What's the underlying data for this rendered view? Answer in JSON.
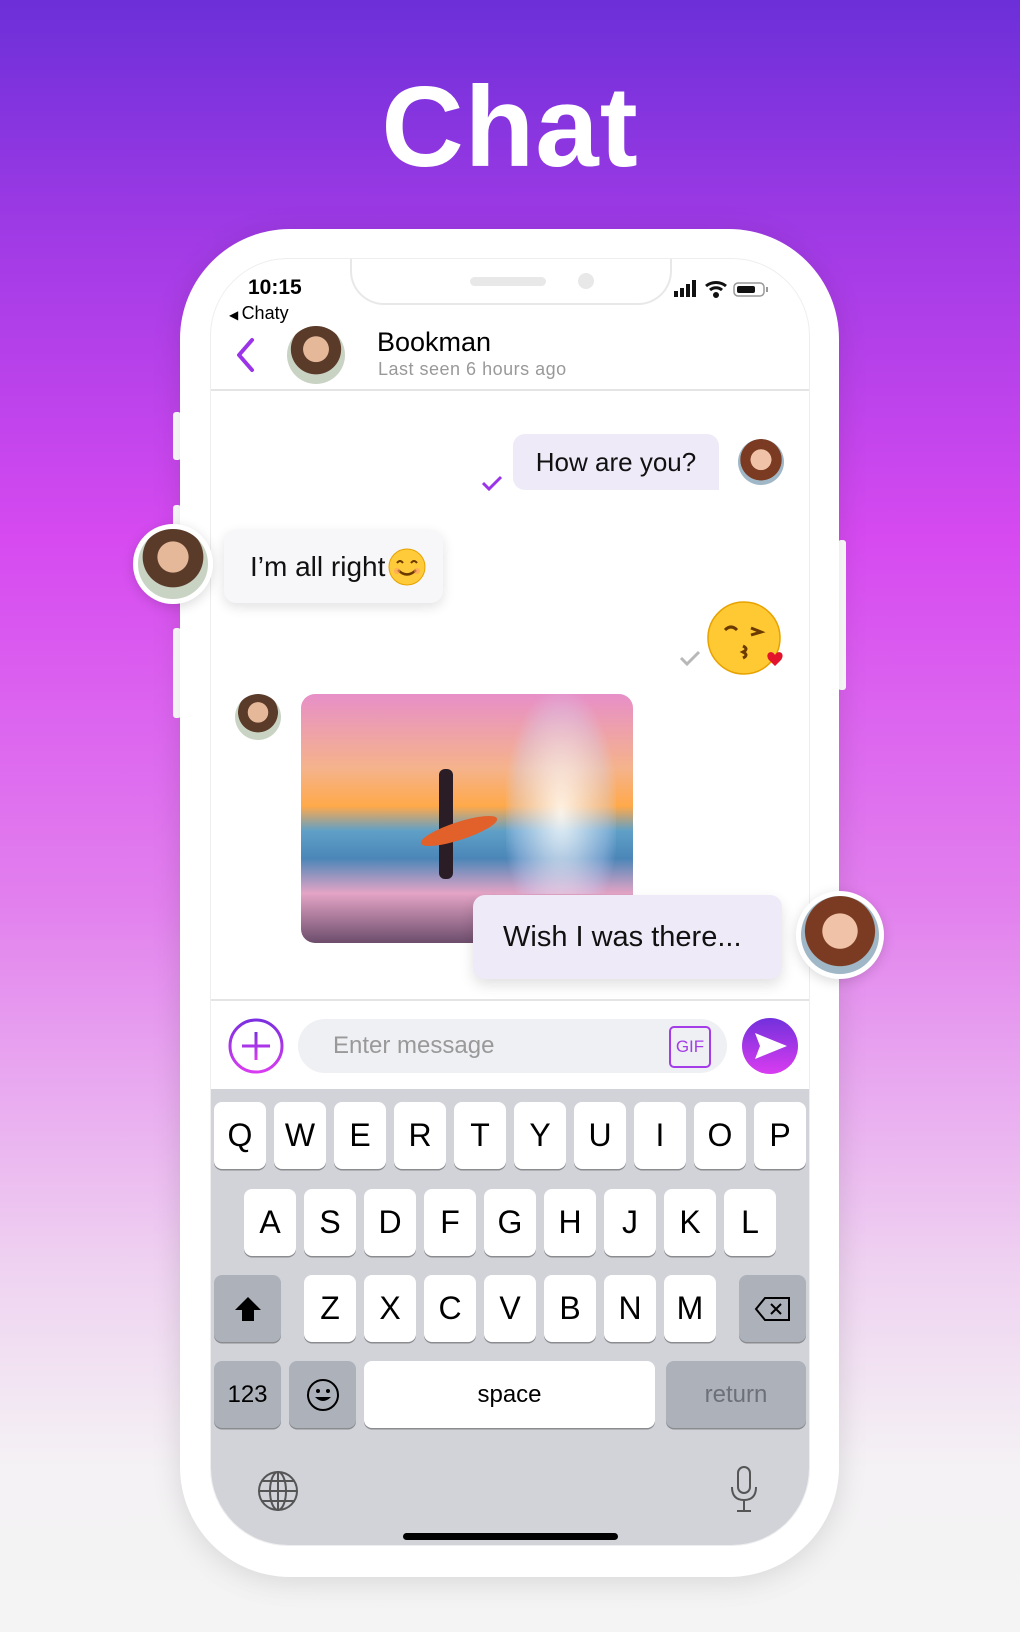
{
  "hero_title": "Chat",
  "status": {
    "time": "10:15",
    "back_app": "Chaty"
  },
  "header": {
    "name": "Bookman",
    "last_seen": "Last seen 6 hours ago"
  },
  "messages": [
    {
      "from": "me",
      "text": "How are you?",
      "status": "read"
    },
    {
      "from": "them",
      "text": "I’m all right",
      "emoji": "smiling-face"
    },
    {
      "from": "me",
      "emoji": "kissing-face-heart",
      "status": "sent"
    },
    {
      "from": "them",
      "image": "surfer-sunset-photo"
    },
    {
      "from": "me",
      "text": "Wish I was there..."
    }
  ],
  "composer": {
    "placeholder": "Enter message",
    "gif_label": "GIF"
  },
  "keyboard": {
    "row1": [
      "Q",
      "W",
      "E",
      "R",
      "T",
      "Y",
      "U",
      "I",
      "O",
      "P"
    ],
    "row2": [
      "A",
      "S",
      "D",
      "F",
      "G",
      "H",
      "J",
      "K",
      "L"
    ],
    "row3": [
      "Z",
      "X",
      "C",
      "V",
      "B",
      "N",
      "M"
    ],
    "numbers": "123",
    "space": "space",
    "return": "return"
  },
  "colors": {
    "accent": "#9b33e8",
    "bubble": "#efeaf8",
    "keyboard": "#d1d3d9"
  }
}
